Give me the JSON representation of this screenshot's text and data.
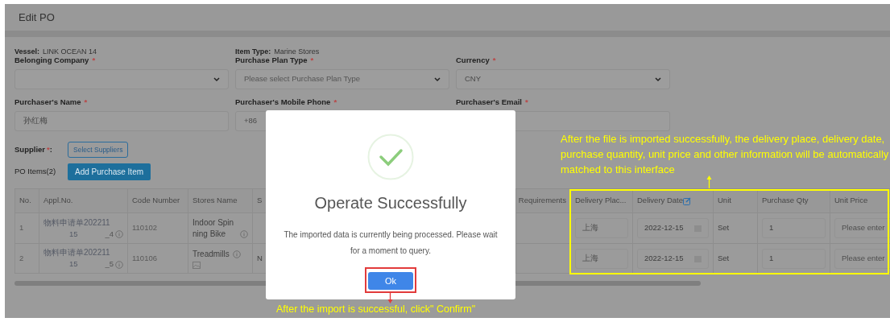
{
  "header": {
    "title": "Edit PO"
  },
  "info": [
    {
      "label": "Vessel:",
      "value": "LINK OCEAN 14"
    },
    {
      "label": "Item Type:",
      "value": "Marine Stores"
    }
  ],
  "fields": [
    {
      "label": "Belonging Company",
      "required_mark": "*",
      "kind": "select"
    },
    {
      "label": "Purchase Plan Type",
      "required_mark": "*",
      "kind": "select",
      "placeholder": "Please select Purchase Plan Type"
    },
    {
      "label": "Currency",
      "required_mark": "*",
      "kind": "select",
      "value": "CNY"
    },
    {
      "label": "Purchaser's Name",
      "required_mark": "*",
      "kind": "text",
      "value": "孙红梅"
    },
    {
      "label": "Purchaser's Mobile Phone",
      "required_mark": "*",
      "kind": "text",
      "value": "+86"
    },
    {
      "label": "Purchaser's Email",
      "required_mark": "*",
      "kind": "text"
    }
  ],
  "supplier": {
    "label": "Supplier",
    "required_mark": "*",
    "suffix": ":",
    "button": "Select Suppliers"
  },
  "po_items": {
    "label": "PO Items(2)",
    "button": "Add Purchase Item"
  },
  "table": {
    "columns": [
      "No.",
      "Appl.No.",
      "Code Number",
      "Stores Name",
      "S",
      "Requirements",
      "Delivery Plac...",
      "Delivery Date",
      "Unit",
      "Purchase Qty",
      "Unit Price"
    ],
    "rows": [
      {
        "no": "1",
        "appl_no": [
          "物料申请单202211",
          "15",
          "_4"
        ],
        "code": "110102",
        "name": "Indoor Spinning Bike",
        "has_image": false,
        "delivery_place": "上海",
        "delivery_date": "2022-12-15",
        "unit": "Set",
        "qty": "1",
        "unit_price_placeholder": "Please enter"
      },
      {
        "no": "2",
        "appl_no": [
          "物料申请单202211",
          "15",
          "_5"
        ],
        "code": "110106",
        "name": "Treadmills",
        "has_image": true,
        "column_5": "N",
        "delivery_place": "上海",
        "delivery_date": "2022-12-15",
        "unit": "Set",
        "qty": "1",
        "unit_price_placeholder": "Please enter"
      }
    ]
  },
  "dialog": {
    "title": "Operate Successfully",
    "message": "The imported data is currently being processed. Please wait for a moment to query.",
    "button": "Ok"
  },
  "annotations": [
    {
      "kind": "top",
      "text": "After the file is imported successfully, the delivery place, delivery date, purchase quantity, unit price and other information will be automatically matched to this interface"
    },
    {
      "kind": "bottom",
      "text": "After the import is successful, click\" Confirm\""
    }
  ]
}
